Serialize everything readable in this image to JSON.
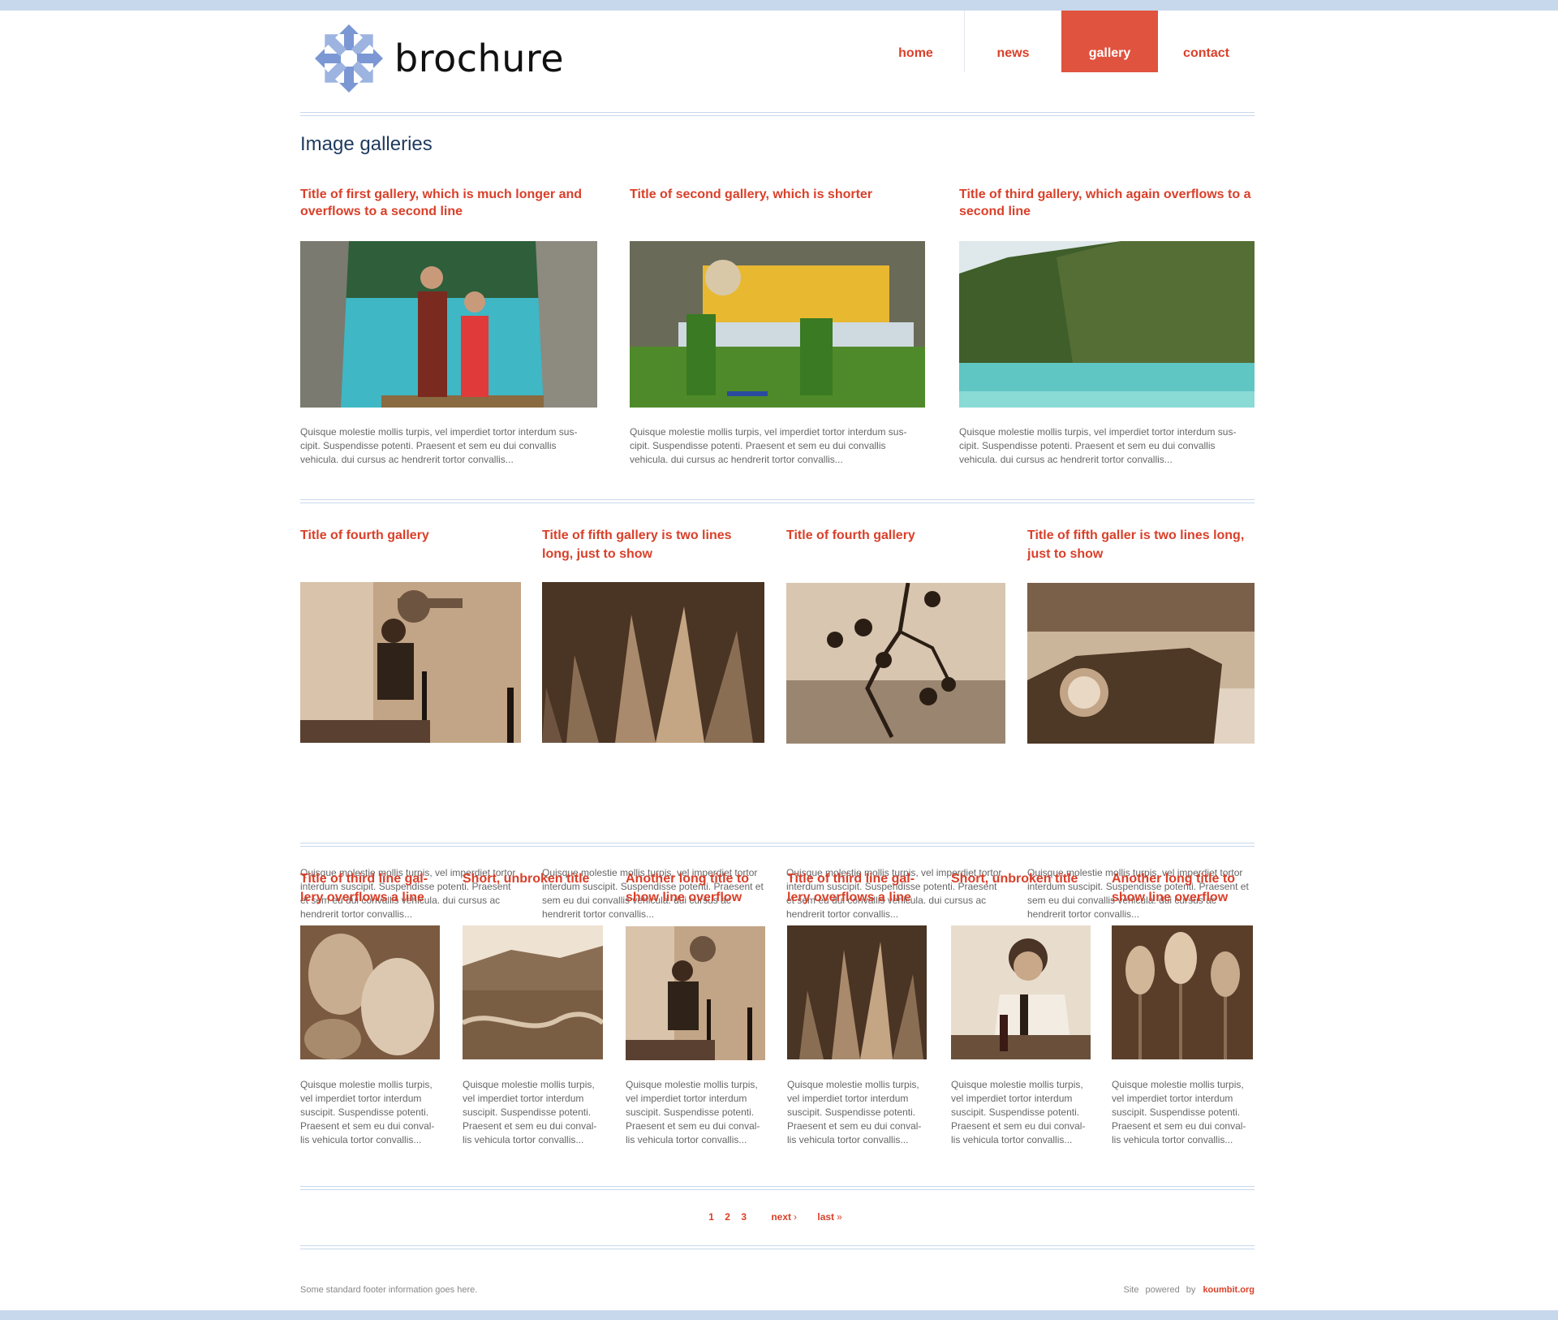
{
  "site": {
    "logo_text": "brochure",
    "colors": {
      "accent": "#e0533e",
      "link": "#d9402a",
      "rule": "#c8d8ec",
      "heading": "#1e3a5f",
      "logo_blue": "#7b97d4"
    }
  },
  "nav": {
    "items": [
      {
        "label": "home",
        "active": false
      },
      {
        "label": "news",
        "active": false
      },
      {
        "label": "gallery",
        "active": true
      },
      {
        "label": "contact",
        "active": false
      }
    ]
  },
  "page_title": "Image galleries",
  "row1": [
    {
      "title": "Title of first gallery, which is much longer and overflows to a second line",
      "text": "Quisque molestie mollis turpis, vel imperdiet tortor interdum sus-cipit. Suspendisse potenti. Praesent et sem eu dui convallis vehicula. dui cursus ac hendrerit tortor convallis...",
      "image": "couple-at-tropical-lagoon"
    },
    {
      "title": "Title of second gallery, which is shorter",
      "text": "Quisque molestie mollis turpis, vel imperdiet tortor interdum sus-cipit. Suspendisse potenti. Praesent et sem eu dui convallis vehicula. dui cursus ac hendrerit tortor convallis...",
      "image": "reclining-golden-buddha"
    },
    {
      "title": "Title of third gallery, which again overflows to a second line",
      "text": "Quisque molestie mollis turpis, vel imperdiet tortor interdum sus-cipit. Suspendisse potenti. Praesent et sem eu dui convallis vehicula. dui cursus ac hendrerit tortor convallis...",
      "image": "limestone-cliffs-and-sea"
    }
  ],
  "row2": [
    {
      "title": "Title of fourth gallery",
      "text": "Quisque molestie mollis turpis, vel imperdiet tortor interdum suscipit. Suspendisse potenti. Praesent et sem eu dui convallis vehicula. dui cursus ac hendrerit tortor convallis...",
      "image": "camera-operator-sepia"
    },
    {
      "title": "Title of fifth gallery is two lines long, just to show",
      "text": "Quisque molestie mollis turpis, vel imperdiet tortor interdum suscipit. Suspendisse potenti. Praesent et sem eu dui convallis vehicula. dui cursus ac hendrerit tortor convallis...",
      "image": "leaves-sepia"
    },
    {
      "title": "Title of fourth gallery",
      "text": "Quisque molestie mollis turpis, vel imperdiet tortor interdum suscipit. Suspendisse potenti. Praesent et sem eu dui convallis vehicula. dui cursus ac hendrerit tortor convallis...",
      "image": "berries-on-branch-sepia"
    },
    {
      "title": "Title of fifth galler is two lines long, just to show",
      "text": "Quisque molestie mollis turpis, vel imperdiet tortor interdum suscipit. Suspendisse potenti. Praesent et sem eu dui convallis vehicula. dui cursus ac hendrerit tortor convallis...",
      "image": "tree-stump-with-knob-sepia"
    }
  ],
  "row3": [
    {
      "title": "Title of third line gal-lery overflows a line",
      "text": "Quisque molestie mollis turpis, vel imperdiet tortor interdum suscipit. Suspendisse potenti. Praesent et sem eu dui conval-lis vehicula tortor convallis...",
      "image": "shells-sepia"
    },
    {
      "title": "Short, unbroken title",
      "text": "Quisque molestie mollis turpis, vel imperdiet tortor interdum suscipit. Suspendisse potenti. Praesent et sem eu dui conval-lis vehicula tortor convallis...",
      "image": "river-valley-sepia"
    },
    {
      "title": "Another long title to show line overflow",
      "text": "Quisque molestie mollis turpis, vel imperdiet tortor interdum suscipit. Suspendisse potenti. Praesent et sem eu dui conval-lis vehicula tortor convallis...",
      "image": "camera-operator-sepia"
    },
    {
      "title": "Title of third line gal-lery overflows a line",
      "text": "Quisque molestie mollis turpis, vel imperdiet tortor interdum suscipit. Suspendisse potenti. Praesent et sem eu dui conval-lis vehicula tortor convallis...",
      "image": "leaves-sepia"
    },
    {
      "title": "Short, unbroken title",
      "text": "Quisque molestie mollis turpis, vel imperdiet tortor interdum suscipit. Suspendisse potenti. Praesent et sem eu dui conval-lis vehicula tortor convallis...",
      "image": "man-on-phone-sepia"
    },
    {
      "title": "Another long title to show line overflow",
      "text": "Quisque molestie mollis turpis, vel imperdiet tortor interdum suscipit. Suspendisse potenti. Praesent et sem eu dui conval-lis vehicula tortor convallis...",
      "image": "tulips-sepia"
    }
  ],
  "pager": {
    "pages": [
      "1",
      "2",
      "3"
    ],
    "next_label": "next",
    "next_arrow": "›",
    "last_label": "last",
    "last_arrow": "»"
  },
  "footer": {
    "left_text": "Some standard footer information goes here.",
    "powered_text": "Site powered by",
    "powered_link": "koumbit.org"
  }
}
